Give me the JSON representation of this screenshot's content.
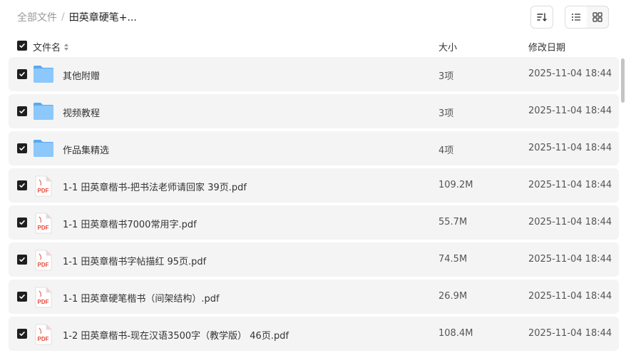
{
  "breadcrumb": {
    "root": "全部文件",
    "separator": "/",
    "current": "田英章硬笔+..."
  },
  "columns": {
    "name": "文件名",
    "size": "大小",
    "date": "修改日期"
  },
  "files": [
    {
      "name": "其他附赠",
      "size": "3项",
      "date": "2025-11-04 18:44",
      "icon": "folder-icon"
    },
    {
      "name": "视频教程",
      "size": "3项",
      "date": "2025-11-04 18:44",
      "icon": "folder-icon"
    },
    {
      "name": "作品集精选",
      "size": "4项",
      "date": "2025-11-04 18:44",
      "icon": "folder-icon"
    },
    {
      "name": "1-1 田英章楷书-把书法老师请回家 39页.pdf",
      "size": "109.2M",
      "date": "2025-11-04 18:44",
      "icon": "pdf-file-icon"
    },
    {
      "name": "1-1 田英章楷书7000常用字.pdf",
      "size": "55.7M",
      "date": "2025-11-04 18:44",
      "icon": "pdf-file-icon"
    },
    {
      "name": "1-1 田英章楷书字帖描红 95页.pdf",
      "size": "74.5M",
      "date": "2025-11-04 18:44",
      "icon": "pdf-file-icon"
    },
    {
      "name": "1-1 田英章硬笔楷书（间架结构）.pdf",
      "size": "26.9M",
      "date": "2025-11-04 18:44",
      "icon": "pdf-file-icon"
    },
    {
      "name": "1-2 田英章楷书-现在汉语3500字（教学版） 46页.pdf",
      "size": "108.4M",
      "date": "2025-11-04 18:44",
      "icon": "pdf-file-icon"
    }
  ],
  "pdf_badge": "PDF",
  "colors": {
    "row_bg": "#f4f4f5",
    "checkbox": "#1f1f1f",
    "folder": "#6cb6f5",
    "pdf_red": "#e5493a"
  }
}
